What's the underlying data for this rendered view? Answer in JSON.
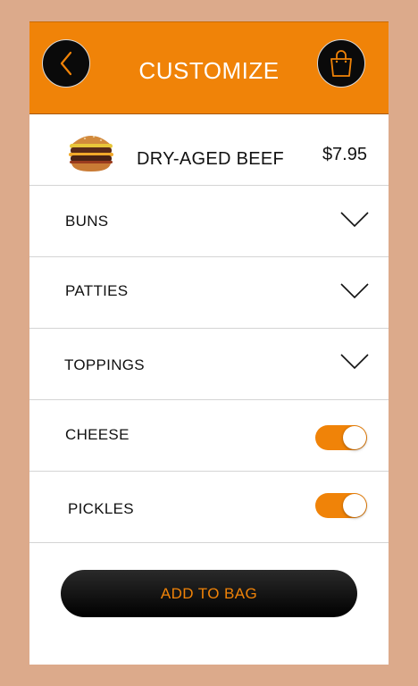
{
  "colors": {
    "background": "#dcaa8b",
    "accent": "#f08308",
    "header_button": "#0a0a0a"
  },
  "header": {
    "title": "CUSTOMIZE",
    "back_icon": "chevron-left-icon",
    "bag_icon": "shopping-bag-icon"
  },
  "product": {
    "name": "DRY-AGED BEEF",
    "price": "$7.95",
    "image_icon": "burger-image"
  },
  "options": {
    "buns": {
      "label": "BUNS",
      "icon": "chevron-down-icon"
    },
    "patties": {
      "label": "PATTIES",
      "icon": "chevron-down-icon"
    },
    "toppings": {
      "label": "TOPPINGS",
      "icon": "chevron-down-icon"
    },
    "cheese": {
      "label": "CHEESE",
      "enabled": true
    },
    "pickles": {
      "label": "PICKLES",
      "enabled": true
    }
  },
  "actions": {
    "add_to_bag": "ADD TO BAG"
  }
}
